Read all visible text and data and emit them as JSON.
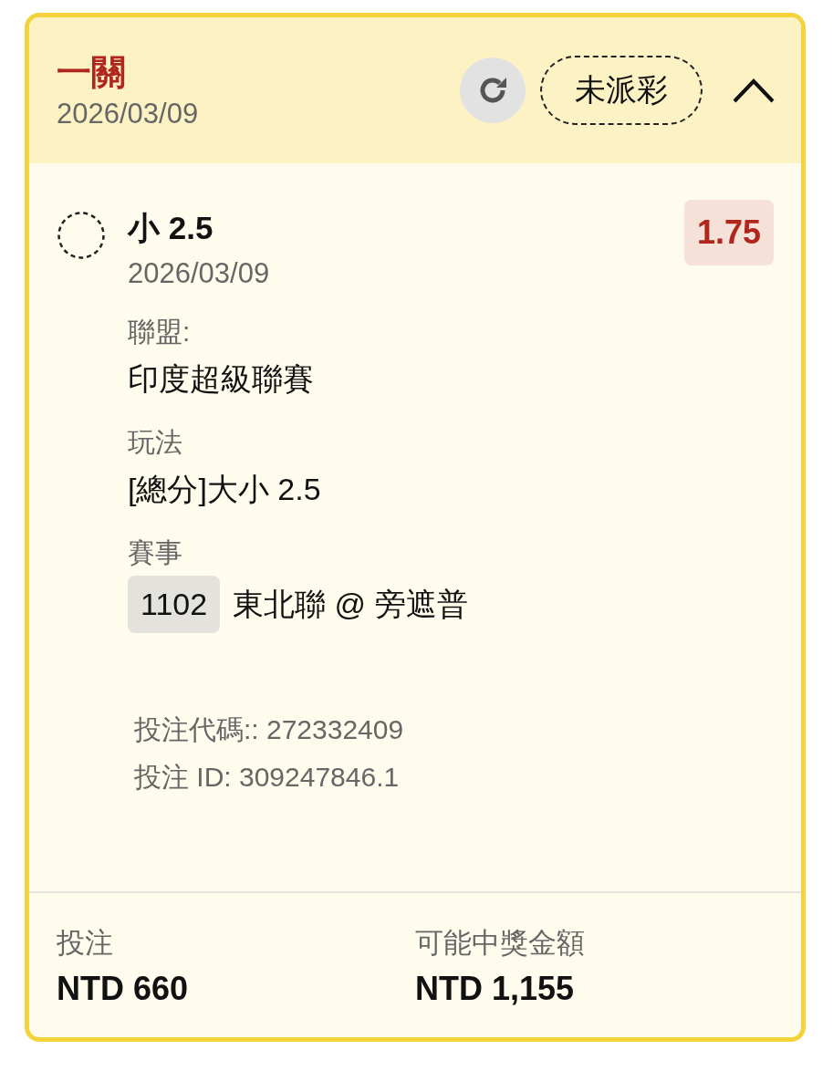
{
  "header": {
    "title": "一關",
    "date": "2026/03/09",
    "status": "未派彩",
    "expanded": true
  },
  "selection": {
    "name": "小 2.5",
    "date": "2026/03/09",
    "odds": "1.75",
    "fields": [
      {
        "label": "聯盟:",
        "value": "印度超級聯賽"
      },
      {
        "label": "玩法",
        "value": "[總分]大小 2.5"
      }
    ],
    "event": {
      "label": "賽事",
      "code": "1102",
      "match": "東北聯 @ 旁遮普"
    }
  },
  "codes": [
    "投注代碼:: 272332409",
    "投注 ID: 309247846.1"
  ],
  "footer": [
    {
      "label": "投注",
      "value": "NTD 660"
    },
    {
      "label": "可能中獎金額",
      "value": "NTD 1,155"
    }
  ]
}
